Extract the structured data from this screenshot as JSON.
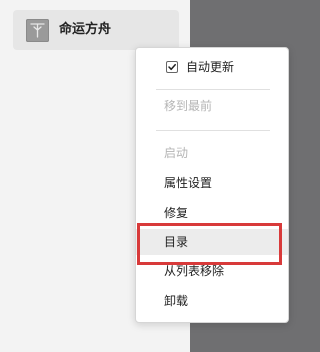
{
  "game": {
    "title": "命运方舟",
    "icon": "game-cover-icon"
  },
  "context_menu": {
    "auto_update": {
      "label": "自动更新",
      "checked": true
    },
    "items": [
      {
        "label": "移到最前",
        "enabled": false
      },
      {
        "label": "启动",
        "enabled": false
      },
      {
        "label": "属性设置",
        "enabled": true
      },
      {
        "label": "修复",
        "enabled": true
      },
      {
        "label": "目录",
        "enabled": true,
        "highlighted": true
      },
      {
        "label": "从列表移除",
        "enabled": true
      },
      {
        "label": "卸载",
        "enabled": true
      }
    ],
    "highlight_color": "#d83a3a"
  }
}
